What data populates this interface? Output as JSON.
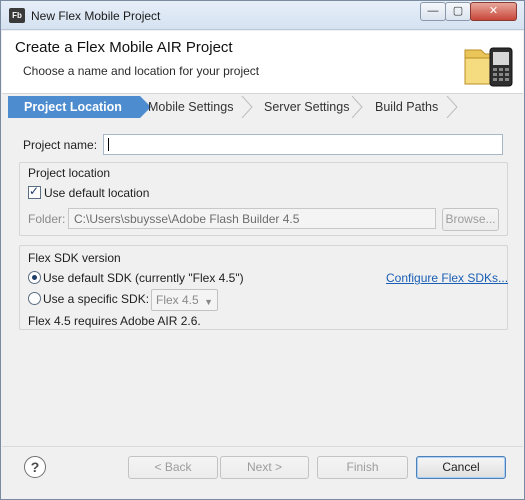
{
  "window": {
    "title": "New Flex Mobile Project",
    "app_icon_text": "Fb",
    "controls": {
      "minimize": "—",
      "maximize": "▢",
      "close": "✕"
    }
  },
  "banner": {
    "title": "Create a Flex Mobile AIR Project",
    "subtitle": "Choose a name and location for your project",
    "icon": "folder-phone-icon"
  },
  "steps": [
    {
      "label": "Project Location",
      "active": true
    },
    {
      "label": "Mobile Settings",
      "active": false
    },
    {
      "label": "Server Settings",
      "active": false
    },
    {
      "label": "Build Paths",
      "active": false
    }
  ],
  "form": {
    "project_name_label": "Project name:",
    "project_name_value": "",
    "location_group_title": "Project location",
    "use_default_location_label": "Use default location",
    "use_default_location_checked": true,
    "folder_label": "Folder:",
    "folder_value": "C:\\Users\\sbuysse\\Adobe Flash Builder 4.5",
    "browse_label": "Browse...",
    "sdk_group_title": "Flex SDK version",
    "use_default_sdk_label": "Use default SDK (currently \"Flex 4.5\")",
    "configure_sdks_link": "Configure Flex SDKs...",
    "use_specific_sdk_label": "Use a specific SDK:",
    "specific_sdk_value": "Flex 4.5",
    "sdk_note": "Flex 4.5 requires Adobe AIR 2.6."
  },
  "buttons": {
    "help": "?",
    "back": "< Back",
    "next": "Next >",
    "finish": "Finish",
    "cancel": "Cancel"
  },
  "colors": {
    "active_step": "#4c8ccf",
    "link": "#1a5fb4"
  }
}
